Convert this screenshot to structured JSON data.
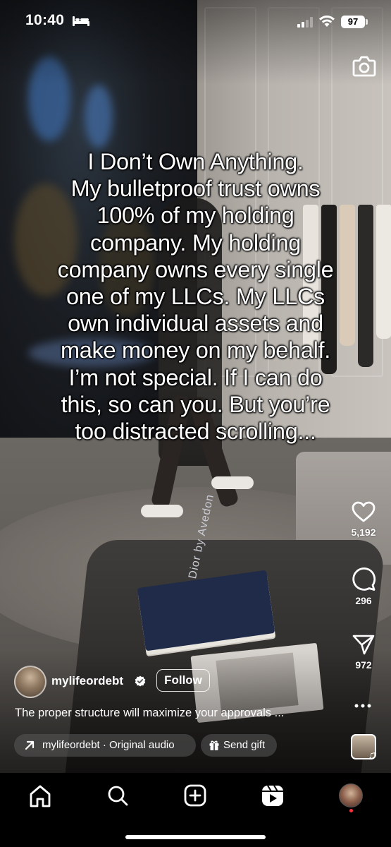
{
  "status_bar": {
    "time": "10:40",
    "battery": "97",
    "icons": [
      "bed-icon",
      "cellular-signal-icon",
      "wifi-icon",
      "battery-icon"
    ]
  },
  "camera": {
    "icon": "camera-icon"
  },
  "caption_lines": [
    "I Don’t Own Anything.",
    "My bulletproof trust owns",
    "100% of my holding",
    "company. My holding",
    "company owns every single",
    "one of my LLCs. My LLCs",
    "own individual assets and",
    "make money on my behalf.",
    "I’m not special. If I can do",
    "this, so can you. But you’re",
    "too distracted scrolling..."
  ],
  "background": {
    "book_title": "Dior by Avedon"
  },
  "actions": {
    "likes": "5,192",
    "comments": "296",
    "shares": "972",
    "icons": [
      "heart-icon",
      "comment-icon",
      "send-icon",
      "more-icon"
    ]
  },
  "author": {
    "username": "mylifeordebt",
    "follow_label": "Follow",
    "verified": true
  },
  "description": "The proper structure will maximize your approvals ...",
  "audio": {
    "label": "mylifeordebt · Original audio",
    "icon": "arrow-up-right-icon"
  },
  "gift": {
    "label": "Send gift",
    "icon": "gift-icon"
  },
  "nav": {
    "items": [
      "home",
      "search",
      "create",
      "reels",
      "profile"
    ],
    "active": "reels",
    "profile_notification": true
  },
  "colors": {
    "notification_dot": "#ff3040",
    "nav_background": "#000000"
  }
}
